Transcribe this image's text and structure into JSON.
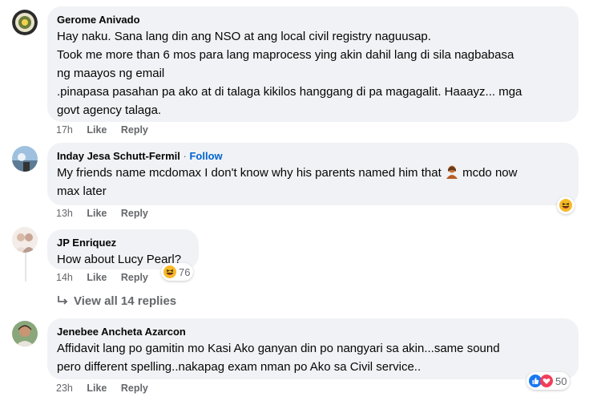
{
  "comments": [
    {
      "author": "Gerome Anivado",
      "lines": [
        "Hay naku. Sana lang din ang NSO at ang local civil registry naguusap.",
        "Took me more than 6 mos para lang maprocess ying akin dahil lang di sila nagbabasa",
        "ng maayos ng email",
        ".pinapasa pasahan pa ako at di talaga kikilos hanggang di pa magagalit. Haaayz... mga",
        "govt agency talaga."
      ],
      "time": "17h",
      "like": "Like",
      "reply": "Reply"
    },
    {
      "author": "Inday Jesa Schutt-Fermil",
      "separator": "·",
      "follow": "Follow",
      "lines": [
        "My friends name mcdomax I don't know why his parents named him that",
        "max later"
      ],
      "inline_after_emoji": "mcdo now",
      "time": "13h",
      "like": "Like",
      "reply": "Reply",
      "reaction_icon": "laugh-emoji"
    },
    {
      "author": "JP Enriquez",
      "lines": [
        "How about Lucy Pearl?"
      ],
      "time": "14h",
      "like": "Like",
      "reply": "Reply",
      "reaction_icon": "laugh-emoji",
      "reaction_count": "76"
    },
    {
      "author": "Jenebee Ancheta Azarcon",
      "lines": [
        "Affidavit lang po gamitin mo Kasi Ako ganyan din po nangyari sa akin...same sound",
        "pero different spelling..nakapag exam nman po Ako sa Civil service.."
      ],
      "time": "23h",
      "like": "Like",
      "reply": "Reply",
      "reaction_icons": [
        "like-icon",
        "love-icon"
      ],
      "reaction_count": "50"
    }
  ],
  "view_replies": "View all 14 replies",
  "colors": {
    "bubble": "#f0f2f5",
    "meta": "#65676b",
    "follow": "#0064d1",
    "like_blue": "#1877f2",
    "love_red": "#f33e58",
    "emoji_yellow": "#f7b928"
  }
}
